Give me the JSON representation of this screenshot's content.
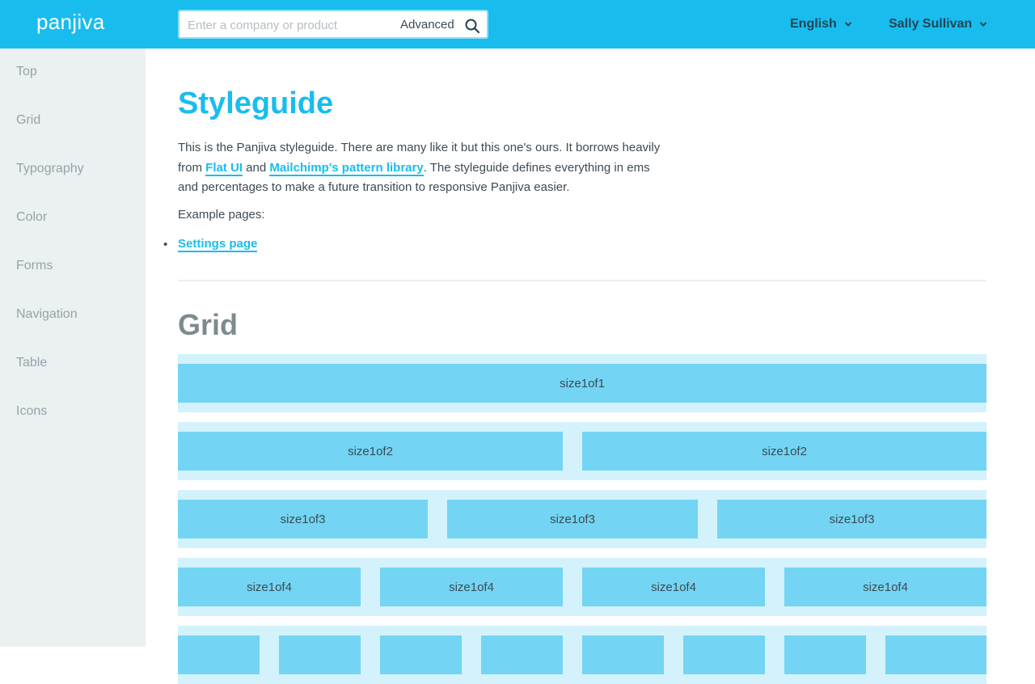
{
  "header": {
    "logo": "panjiva",
    "search": {
      "placeholder": "Enter a company or product",
      "value": "",
      "advanced_label": "Advanced",
      "icon": "search-icon"
    },
    "language": {
      "label": "English",
      "icon": "chevron-down-icon"
    },
    "user": {
      "label": "Sally Sullivan",
      "icon": "chevron-down-icon"
    }
  },
  "sidebar": {
    "items": [
      {
        "label": "Top"
      },
      {
        "label": "Grid"
      },
      {
        "label": "Typography"
      },
      {
        "label": "Color"
      },
      {
        "label": "Forms"
      },
      {
        "label": "Navigation"
      },
      {
        "label": "Table"
      },
      {
        "label": "Icons"
      }
    ]
  },
  "main": {
    "title": "Styleguide",
    "intro": {
      "part1": "This is the Panjiva styleguide. There are many like it but this one's ours. It borrows heavily from ",
      "link1": "Flat UI",
      "part2": " and ",
      "link2": "Mailchimp's pattern library",
      "part3": ". The styleguide defines everything in ems and percentages to make a future transition to responsive Panjiva easier."
    },
    "example_label": "Example pages:",
    "example_pages": [
      {
        "label": "Settings page"
      }
    ],
    "grid_title": "Grid",
    "grid_rows": [
      {
        "cells": [
          "size1of1"
        ]
      },
      {
        "cells": [
          "size1of2",
          "size1of2"
        ]
      },
      {
        "cells": [
          "size1of3",
          "size1of3",
          "size1of3"
        ]
      },
      {
        "cells": [
          "size1of4",
          "size1of4",
          "size1of4",
          "size1of4"
        ]
      },
      {
        "cells": [
          "",
          "",
          "",
          "",
          "",
          "",
          "",
          ""
        ]
      }
    ]
  },
  "colors": {
    "brand": "#18bdee",
    "sidebar_bg": "#ebf0f1",
    "grid_row_bg": "#d3f2fb",
    "grid_cell_bg": "#73d5f3"
  }
}
